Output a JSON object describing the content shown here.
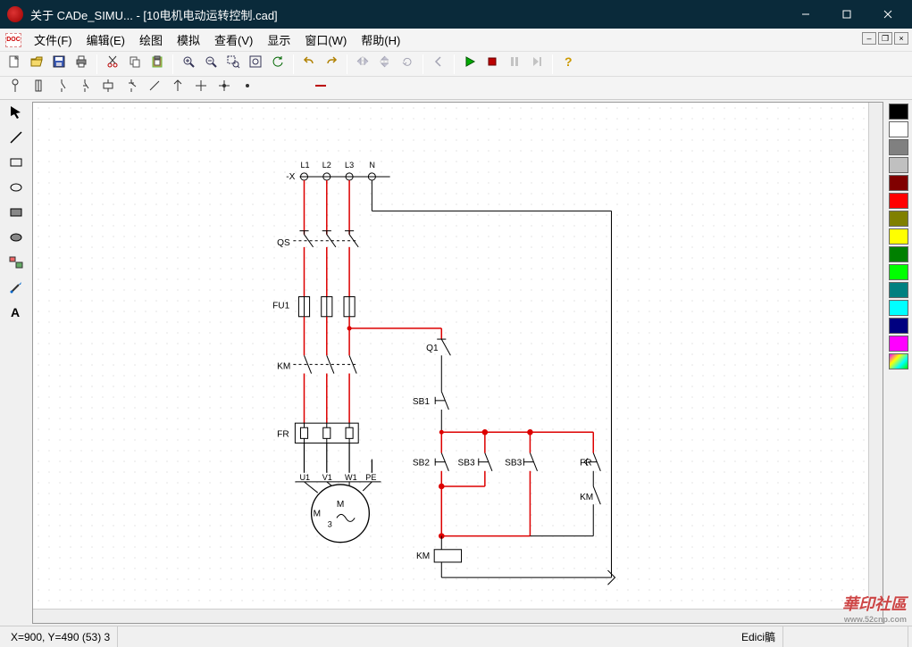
{
  "window": {
    "title": "关于 CADe_SIMU... - [10电机电动运转控制.cad]"
  },
  "menu": {
    "items": [
      "文件(F)",
      "编辑(E)",
      "绘图",
      "模拟",
      "查看(V)",
      "显示",
      "窗口(W)",
      "帮助(H)"
    ]
  },
  "toolbar_icons": [
    "new-doc",
    "open",
    "save",
    "print",
    "|",
    "cut",
    "copy",
    "paste",
    "|",
    "zoom-in",
    "zoom-out",
    "zoom-region",
    "zoom-fit",
    "refresh",
    "|",
    "undo",
    "redo",
    "|",
    "flip-h",
    "flip-v",
    "rotate",
    "sep-small",
    "arrow-left",
    "|",
    "play",
    "stop",
    "pause",
    "step",
    "|",
    "help"
  ],
  "toolbar2_icons": [
    "terminal-o",
    "fuse",
    "contact-no",
    "contact-nc",
    "coil",
    "switch",
    "wire-slash",
    "wire-up",
    "wire-cross",
    "junction",
    "node",
    "blank",
    "dash"
  ],
  "left_tools": [
    "arrow-tool",
    "line-tool",
    "rect-tool",
    "ellipse-tool",
    "fillrect-tool",
    "fillellipse-tool",
    "components-tool",
    "eyedropper-tool",
    "text-tool"
  ],
  "palette_colors": [
    "#000000",
    "#ffffff",
    "#808080",
    "#c0c0c0",
    "#800000",
    "#ff0000",
    "#808000",
    "#ffff00",
    "#008000",
    "#00ff00",
    "#008080",
    "#00ffff",
    "#000080",
    "#ff00ff"
  ],
  "schematic_labels": {
    "X": "-X",
    "L1": "L1",
    "L2": "L2",
    "L3": "L3",
    "N": "N",
    "QS": "QS",
    "FU1": "FU1",
    "KM": "KM",
    "FR": "FR",
    "U1": "U1",
    "V1": "V1",
    "W1": "W1",
    "PE": "PE",
    "M": "M",
    "three": "3",
    "Q1": "Q1",
    "SB1": "SB1",
    "SB2": "SB2",
    "SB3a": "SB3",
    "SB3b": "SB3",
    "FR2": "FR",
    "KM2": "KM",
    "KMcoil": "KM"
  },
  "status": {
    "coords": "X=900, Y=490 (53) 3",
    "mode": "Edici髇"
  },
  "watermark": {
    "text": "華印社區",
    "url": "www.52cnp.com"
  }
}
